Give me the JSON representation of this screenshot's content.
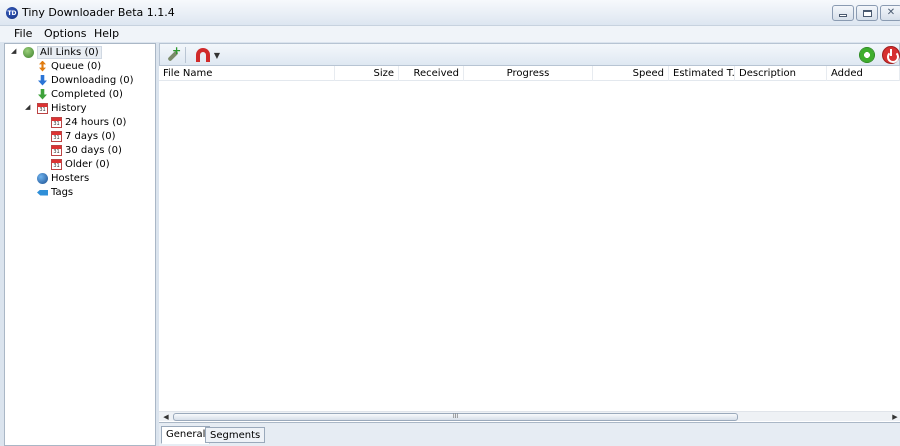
{
  "window": {
    "title": "Tiny Downloader Beta 1.1.4",
    "icon_text": "TD",
    "controls": {
      "minimize": "minimize-icon",
      "maximize": "maximize-icon",
      "close": "close-icon"
    }
  },
  "menu": {
    "items": [
      "File",
      "Options",
      "Help"
    ]
  },
  "tree": {
    "nodes": [
      {
        "label": "All Links (0)",
        "icon": "all-links-icon"
      },
      {
        "label": "Queue (0)",
        "icon": "queue-icon"
      },
      {
        "label": "Downloading (0)",
        "icon": "downloading-icon"
      },
      {
        "label": "Completed (0)",
        "icon": "completed-icon"
      },
      {
        "label": "History",
        "icon": "calendar-icon"
      },
      {
        "label": "24 hours (0)",
        "icon": "calendar-icon"
      },
      {
        "label": "7 days (0)",
        "icon": "calendar-icon"
      },
      {
        "label": "30 days (0)",
        "icon": "calendar-icon"
      },
      {
        "label": "Older (0)",
        "icon": "calendar-icon"
      },
      {
        "label": "Hosters",
        "icon": "globe-icon"
      },
      {
        "label": "Tags",
        "icon": "tag-icon"
      }
    ]
  },
  "toolbar": {
    "add_link_icon": "add-link-icon",
    "magnet_icon": "magnet-icon",
    "settings_icon": "gear-icon",
    "power_icon": "power-icon"
  },
  "table": {
    "columns": [
      "File Name",
      "Size",
      "Received",
      "Progress",
      "Speed",
      "Estimated T...",
      "Description",
      "Added"
    ],
    "rows": []
  },
  "scrollbar": {
    "grip": "III"
  },
  "tabs": [
    "General",
    "Segments"
  ],
  "active_tab": "General"
}
